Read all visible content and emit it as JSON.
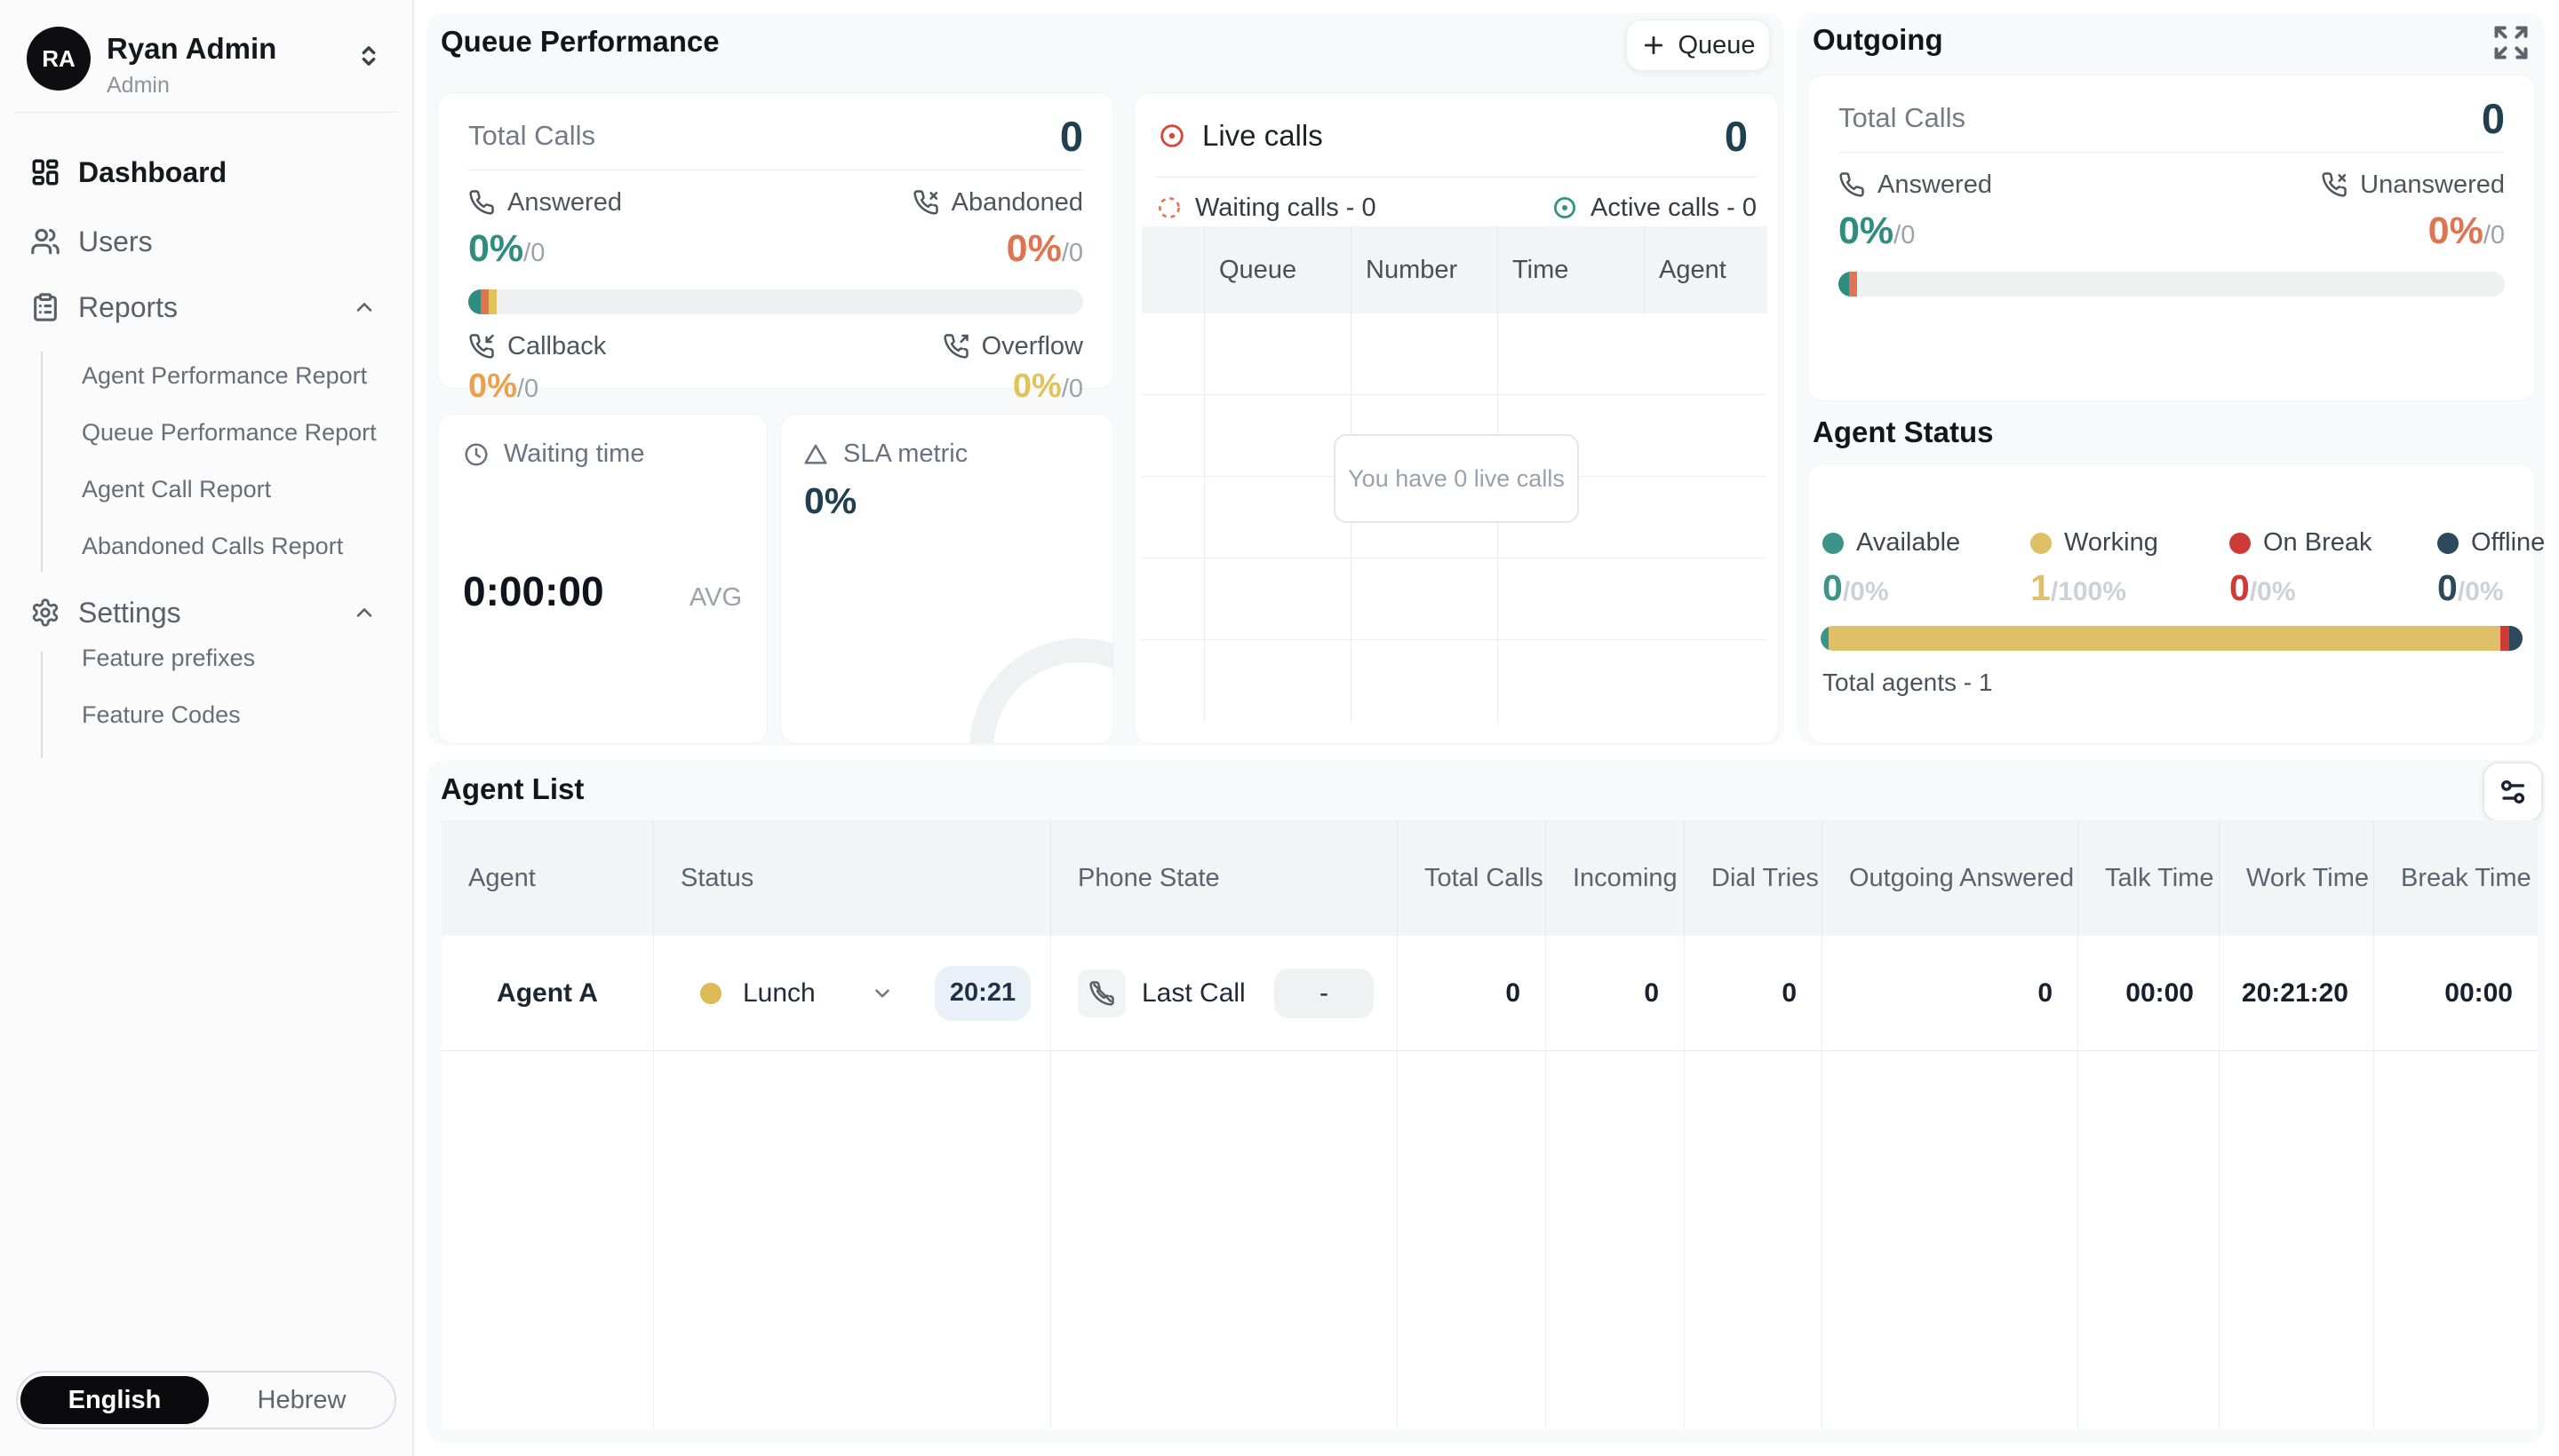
{
  "sidebar": {
    "user": {
      "initials": "RA",
      "name": "Ryan Admin",
      "role": "Admin"
    },
    "nav": {
      "dashboard": "Dashboard",
      "users": "Users",
      "reports": "Reports",
      "reports_children": [
        "Agent Performance Report",
        "Queue Performance Report",
        "Agent Call Report",
        "Abandoned Calls Report"
      ],
      "settings": "Settings",
      "settings_children": [
        "Feature prefixes",
        "Feature Codes"
      ]
    },
    "language": {
      "english": "English",
      "hebrew": "Hebrew"
    }
  },
  "queue_performance": {
    "title": "Queue Performance",
    "queue_button": "Queue",
    "card": {
      "total_label": "Total Calls",
      "total_value": "0",
      "answered": {
        "label": "Answered",
        "pct": "0%",
        "of": "/0"
      },
      "abandoned": {
        "label": "Abandoned",
        "pct": "0%",
        "of": "/0"
      },
      "callback": {
        "label": "Callback",
        "pct": "0%",
        "of": "/0"
      },
      "overflow": {
        "label": "Overflow",
        "pct": "0%",
        "of": "/0"
      }
    },
    "waiting_time": {
      "label": "Waiting time",
      "value": "0:00:00",
      "avg": "AVG"
    },
    "sla": {
      "label": "SLA metric",
      "value": "0%"
    }
  },
  "live_calls": {
    "title": "Live calls",
    "total": "0",
    "waiting": "Waiting calls - 0",
    "active": "Active calls - 0",
    "columns": [
      "Queue",
      "Number",
      "Time",
      "Agent"
    ],
    "empty": "You have 0 live calls"
  },
  "outgoing": {
    "title": "Outgoing",
    "total_label": "Total Calls",
    "total_value": "0",
    "answered": {
      "label": "Answered",
      "pct": "0%",
      "of": "/0"
    },
    "unanswered": {
      "label": "Unanswered",
      "pct": "0%",
      "of": "/0"
    }
  },
  "agent_status": {
    "title": "Agent Status",
    "available": {
      "label": "Available",
      "value": "0",
      "pct": "/0%"
    },
    "working": {
      "label": "Working",
      "value": "1",
      "pct": "/100%"
    },
    "on_break": {
      "label": "On Break",
      "value": "0",
      "pct": "/0%"
    },
    "offline": {
      "label": "Offline",
      "value": "0",
      "pct": "/0%"
    },
    "total": "Total agents - 1"
  },
  "agent_list": {
    "title": "Agent List",
    "columns": [
      "Agent",
      "Status",
      "Phone State",
      "Total Calls",
      "Incoming",
      "Dial Tries",
      "Outgoing Answered",
      "Talk Time",
      "Work Time",
      "Break Time"
    ],
    "row": {
      "agent": "Agent A",
      "status": "Lunch",
      "status_timer": "20:21",
      "phone_label": "Last Call",
      "phone_value": "-",
      "total_calls": "0",
      "incoming": "0",
      "dial_tries": "0",
      "outgoing_answered": "0",
      "talk_time": "00:00",
      "work_time": "20:21:20",
      "break_time": "00:00"
    }
  },
  "colors": {
    "answered_teal": "#2E8C80",
    "abandoned_red": "#DF7450",
    "callback_orange": "#ECA04B",
    "overflow_yellow": "#E2C25B",
    "working_yellow": "#DFC069",
    "on_break_red": "#CE3A36",
    "offline_navy": "#2C4A5C",
    "number_navy": "#204050"
  }
}
